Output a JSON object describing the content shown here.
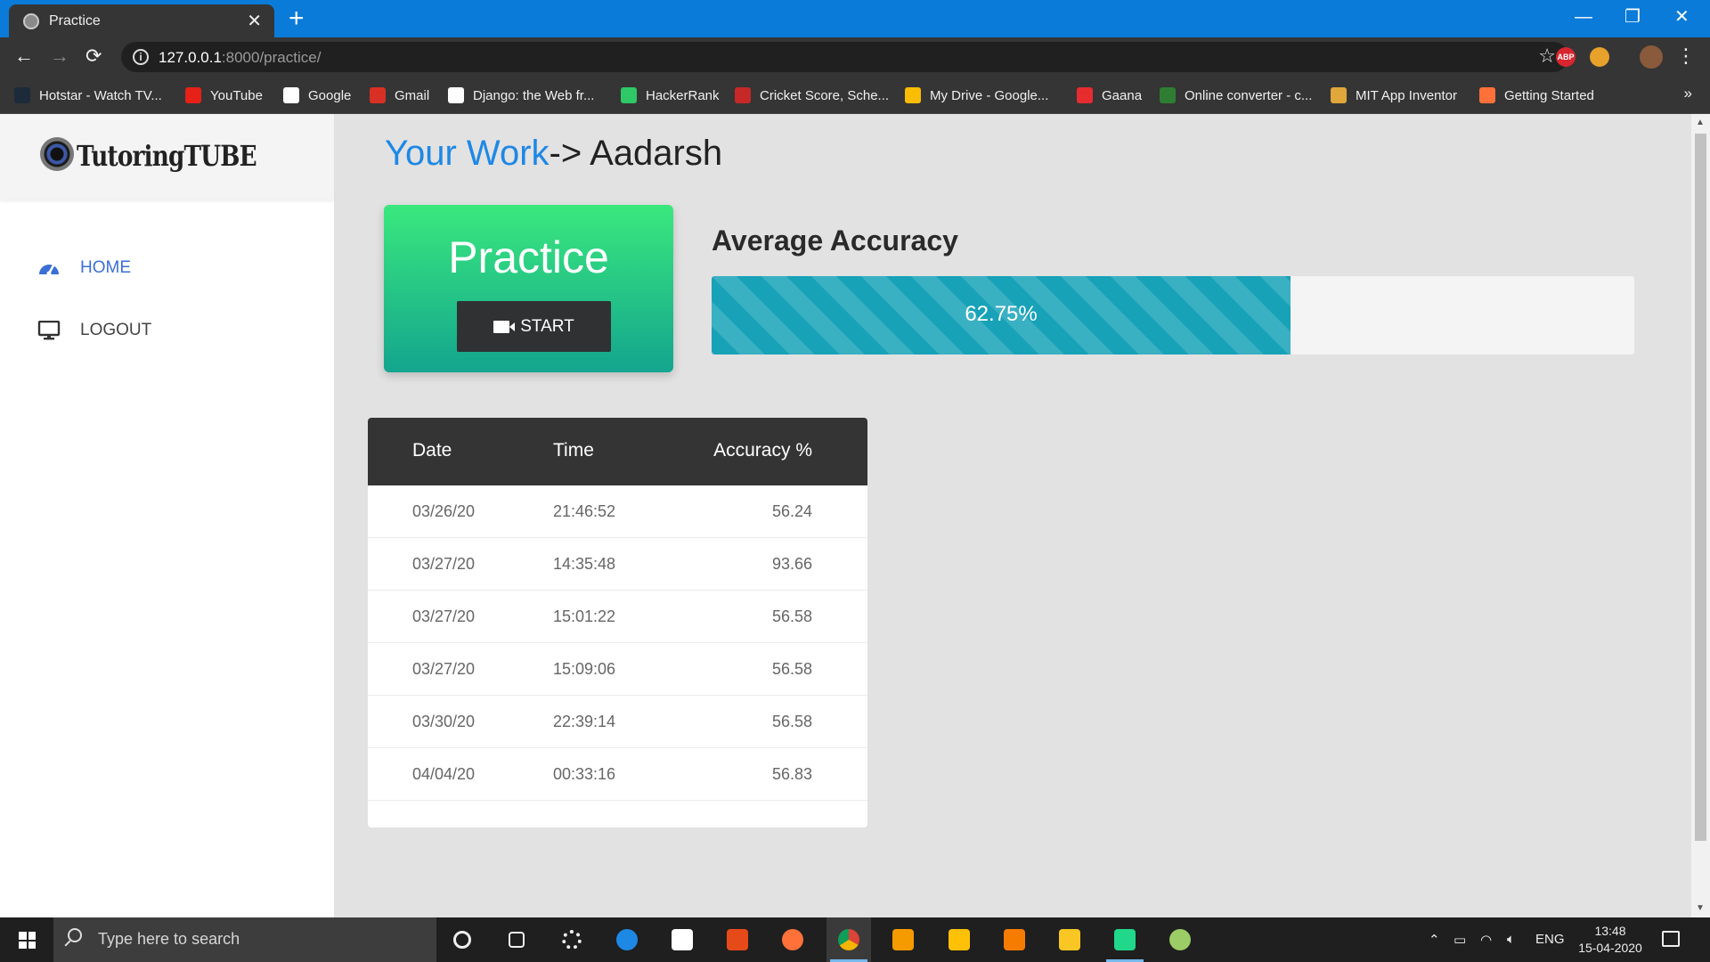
{
  "browser": {
    "tab_title": "Practice",
    "tab_close": "✕",
    "new_tab": "+",
    "window_controls": {
      "minimize": "—",
      "restore": "❐",
      "close": "✕"
    },
    "url_host": "127.0.0.1",
    "url_path": ":8000/practice/",
    "star": "☆",
    "extensions": [
      {
        "name": "adblock-plus",
        "label": "ABP",
        "color": "#d7262f"
      },
      {
        "name": "cookie-extension",
        "label": "",
        "color": "#e8a12b"
      },
      {
        "name": "profile-avatar",
        "label": "",
        "color": "#8a5a3c"
      }
    ],
    "bookmarks": [
      {
        "label": "Hotstar - Watch TV...",
        "icon_color": "#1c2a3a",
        "icon": "hotstar-icon"
      },
      {
        "label": "YouTube",
        "icon_color": "#e62117",
        "icon": "youtube-icon"
      },
      {
        "label": "Google",
        "icon_color": "#ffffff",
        "icon": "google-icon"
      },
      {
        "label": "Gmail",
        "icon_color": "#d93025",
        "icon": "gmail-icon"
      },
      {
        "label": "Django: the Web fr...",
        "icon_color": "#ffffff",
        "icon": "django-icon"
      },
      {
        "label": "HackerRank",
        "icon_color": "#2ec866",
        "icon": "hackerrank-icon"
      },
      {
        "label": "Cricket Score, Sche...",
        "icon_color": "#c62828",
        "icon": "cricket-icon"
      },
      {
        "label": "My Drive - Google...",
        "icon_color": "#fbbc04",
        "icon": "drive-icon"
      },
      {
        "label": "Gaana",
        "icon_color": "#e72c30",
        "icon": "gaana-icon"
      },
      {
        "label": "Online converter - c...",
        "icon_color": "#2e7d32",
        "icon": "converter-icon"
      },
      {
        "label": "MIT App Inventor",
        "icon_color": "#e1a73b",
        "icon": "appinventor-icon"
      },
      {
        "label": "Getting Started",
        "icon_color": "#ff7139",
        "icon": "firefox-icon"
      }
    ],
    "bookmarks_more": "»"
  },
  "sidebar": {
    "logo_text": "TutoringTUBE",
    "items": [
      {
        "label": "HOME",
        "icon": "dashboard-icon",
        "active": true
      },
      {
        "label": "LOGOUT",
        "icon": "monitor-icon",
        "active": false
      }
    ]
  },
  "main": {
    "heading_prefix": "Your Work",
    "heading_suffix": "-> Aadarsh",
    "practice_card": {
      "title": "Practice",
      "button_label": "START"
    },
    "accuracy": {
      "title": "Average Accuracy",
      "value_label": "62.75%",
      "value": 62.75
    },
    "table": {
      "headers": [
        "Date",
        "Time",
        "Accuracy %"
      ],
      "rows": [
        [
          "03/26/20",
          "21:46:52",
          "56.24"
        ],
        [
          "03/27/20",
          "14:35:48",
          "93.66"
        ],
        [
          "03/27/20",
          "15:01:22",
          "56.58"
        ],
        [
          "03/27/20",
          "15:09:06",
          "56.58"
        ],
        [
          "03/30/20",
          "22:39:14",
          "56.58"
        ],
        [
          "04/04/20",
          "00:33:16",
          "56.83"
        ]
      ]
    }
  },
  "taskbar": {
    "search_placeholder": "Type here to search",
    "language": "ENG",
    "time": "13:48",
    "date": "15-04-2020",
    "apps": [
      {
        "name": "cortana-icon",
        "color": "#1f1f1f"
      },
      {
        "name": "task-view-icon",
        "color": "#1f1f1f"
      },
      {
        "name": "settings-icon",
        "color": "#1f1f1f"
      },
      {
        "name": "edge-icon",
        "color": "#1e88e5"
      },
      {
        "name": "store-icon",
        "color": "#ffffff"
      },
      {
        "name": "office-icon",
        "color": "#e64a19"
      },
      {
        "name": "firefox-icon",
        "color": "#ff7139"
      },
      {
        "name": "chrome-icon",
        "color": "#4caf50"
      },
      {
        "name": "sublime-icon",
        "color": "#f59b00"
      },
      {
        "name": "app-icon",
        "color": "#ffc107"
      },
      {
        "name": "vlc-icon",
        "color": "#f57c00"
      },
      {
        "name": "file-explorer-icon",
        "color": "#f9c623"
      },
      {
        "name": "pycharm-icon",
        "color": "#21d789"
      },
      {
        "name": "paint-icon",
        "color": "#9ccc65"
      }
    ]
  }
}
